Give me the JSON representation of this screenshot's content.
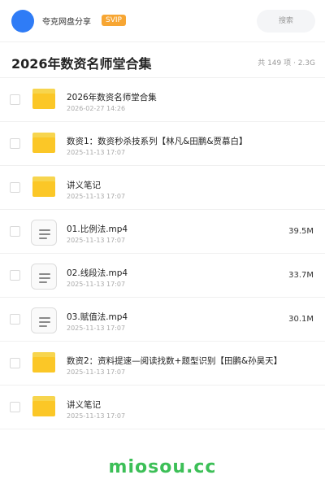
{
  "header": {
    "share_name": "夸克网盘分享",
    "badge": "SVIP",
    "search_placeholder": "搜索"
  },
  "folder": {
    "title": "2026年数资名师堂合集",
    "summary": "共 149 项 · 2.3G"
  },
  "items": [
    {
      "type": "folder",
      "name": "2026年数资名师堂合集",
      "date": "2026-02-27 14:26",
      "size": ""
    },
    {
      "type": "folder",
      "name": "数资1：数资秒杀技系列【林凡&田鹏&贾慕白】",
      "date": "2025-11-13 17:07",
      "size": ""
    },
    {
      "type": "folder",
      "name": "讲义笔记",
      "date": "2025-11-13 17:07",
      "size": ""
    },
    {
      "type": "file",
      "name": "01.比例法.mp4",
      "date": "2025-11-13 17:07",
      "size": "39.5M"
    },
    {
      "type": "file",
      "name": "02.线段法.mp4",
      "date": "2025-11-13 17:07",
      "size": "33.7M"
    },
    {
      "type": "file",
      "name": "03.赋值法.mp4",
      "date": "2025-11-13 17:07",
      "size": "30.1M"
    },
    {
      "type": "folder",
      "name": "数资2：资料提速—阅读找数+题型识别【田鹏&孙昊天】",
      "date": "2025-11-13 17:07",
      "size": ""
    },
    {
      "type": "folder",
      "name": "讲义笔记",
      "date": "2025-11-13 17:07",
      "size": ""
    }
  ],
  "watermark": "miosou.cc",
  "colors": {
    "accent": "#2f7cf6",
    "svip": "#f7a633",
    "folder": "#fbc727",
    "watermark": "#3cbf57"
  }
}
